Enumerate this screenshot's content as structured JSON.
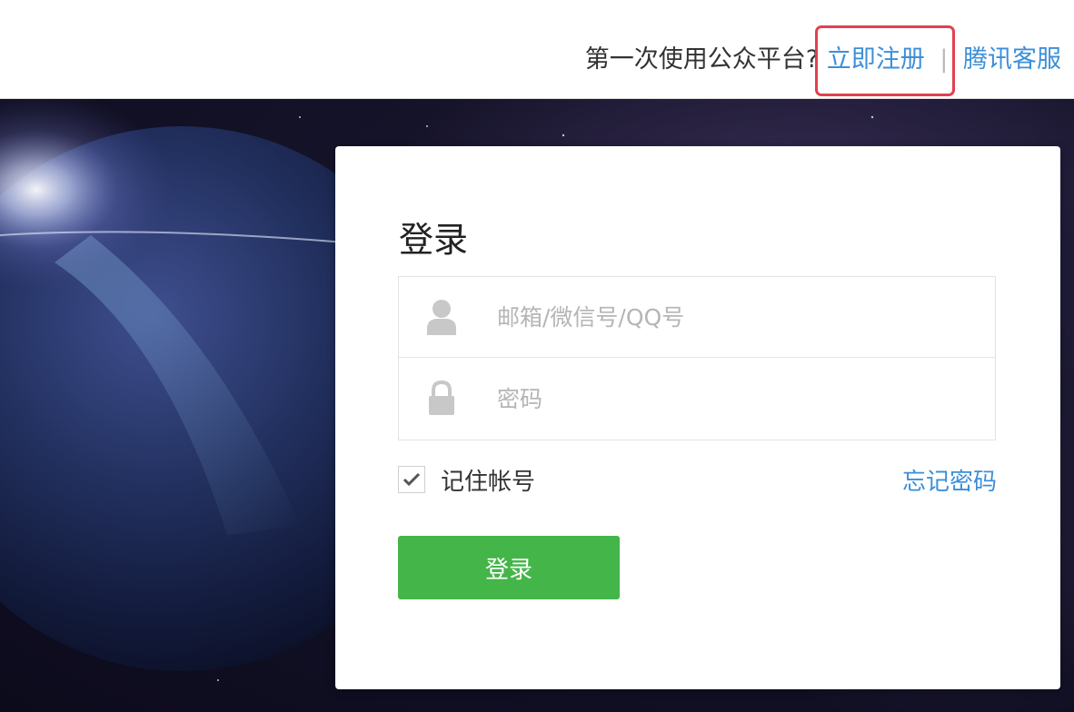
{
  "header": {
    "prompt_text": "第一次使用公众平台?",
    "register_link": "立即注册",
    "separator": "|",
    "support_link": "腾讯客服"
  },
  "login": {
    "title": "登录",
    "username_placeholder": "邮箱/微信号/QQ号",
    "password_placeholder": "密码",
    "remember_label": "记住帐号",
    "remember_checked": true,
    "forgot_link": "忘记密码",
    "submit_label": "登录"
  },
  "icons": {
    "user": "user-icon",
    "lock": "lock-icon",
    "check": "checkmark-icon"
  },
  "colors": {
    "link": "#3c8fd8",
    "button": "#44b549",
    "highlight": "#e2404f",
    "background": "#151329"
  }
}
